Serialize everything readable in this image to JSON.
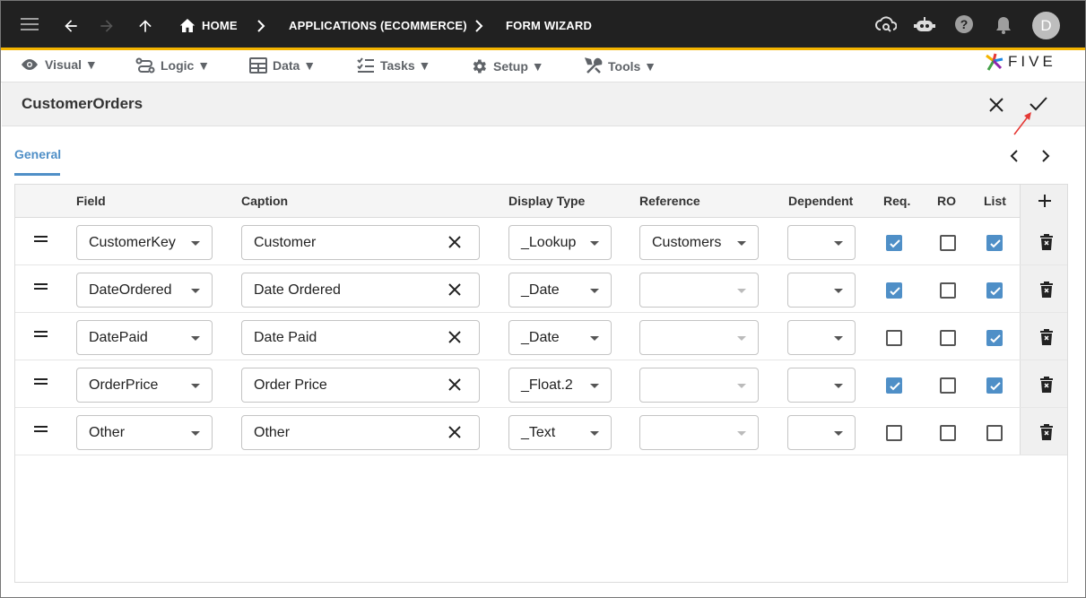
{
  "breadcrumb": {
    "home": "HOME",
    "applications": "APPLICATIONS (ECOMMERCE)",
    "current": "FORM WIZARD"
  },
  "user": {
    "initial": "D"
  },
  "menu": {
    "visual": "Visual ▼",
    "logic": "Logic ▼",
    "data": "Data ▼",
    "tasks": "Tasks ▼",
    "setup": "Setup ▼",
    "tools": "Tools ▼"
  },
  "brand": {
    "name": "FIVE"
  },
  "page": {
    "title": "CustomerOrders"
  },
  "tabs": [
    {
      "label": "General",
      "active": true
    }
  ],
  "columns": {
    "field": "Field",
    "caption": "Caption",
    "display_type": "Display Type",
    "reference": "Reference",
    "dependent": "Dependent",
    "req": "Req.",
    "ro": "RO",
    "list": "List"
  },
  "rows": [
    {
      "field": "CustomerKey",
      "caption": "Customer",
      "display_type": "_Lookup",
      "reference": "Customers",
      "dependent": "",
      "req": true,
      "ro": false,
      "list": true
    },
    {
      "field": "DateOrdered",
      "caption": "Date Ordered",
      "display_type": "_Date",
      "reference": "",
      "dependent": "",
      "req": true,
      "ro": false,
      "list": true
    },
    {
      "field": "DatePaid",
      "caption": "Date Paid",
      "display_type": "_Date",
      "reference": "",
      "dependent": "",
      "req": false,
      "ro": false,
      "list": true
    },
    {
      "field": "OrderPrice",
      "caption": "Order Price",
      "display_type": "_Float.2",
      "reference": "",
      "dependent": "",
      "req": true,
      "ro": false,
      "list": true
    },
    {
      "field": "Other",
      "caption": "Other",
      "display_type": "_Text",
      "reference": "",
      "dependent": "",
      "req": false,
      "ro": false,
      "list": false
    }
  ],
  "colors": {
    "topbar": "#212121",
    "accent_bar": "#f4b400",
    "primary": "#4f8fc7",
    "annotation_arrow": "#e53935"
  }
}
